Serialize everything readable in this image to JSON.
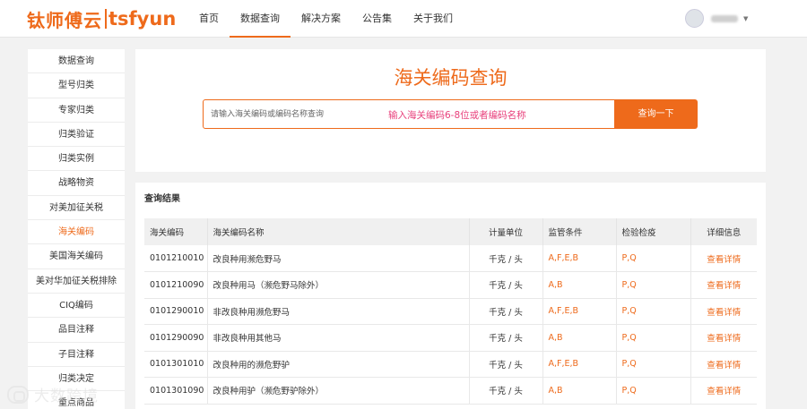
{
  "header": {
    "logo_cn": "钛师傅云",
    "logo_en": "tsfyun",
    "nav": [
      "首页",
      "数据查询",
      "解决方案",
      "公告集",
      "关于我们"
    ],
    "active_nav": "数据查询"
  },
  "sidebar": {
    "items": [
      "数据查询",
      "型号归类",
      "专家归类",
      "归类验证",
      "归类实例",
      "战略物资",
      "对美加征关税",
      "海关编码",
      "美国海关编码",
      "美对华加征关税排除",
      "CIQ编码",
      "品目注释",
      "子目注释",
      "归类决定",
      "重点商品"
    ],
    "active_item": "海关编码"
  },
  "search": {
    "title": "海关编码查询",
    "placeholder": "请输入海关编码或编码名称查询",
    "hint": "输入海关编码6-8位或者编码名称",
    "button": "查询一下"
  },
  "results": {
    "title": "查询结果",
    "columns": [
      "海关编码",
      "海关编码名称",
      "计量单位",
      "监管条件",
      "检验检疫",
      "详细信息"
    ],
    "rows": [
      [
        "0101210010",
        "改良种用濒危野马",
        "千克 / 头",
        "A,F,E,B",
        "P,Q",
        "查看详情"
      ],
      [
        "0101210090",
        "改良种用马（濒危野马除外）",
        "千克 / 头",
        "A,B",
        "P,Q",
        "查看详情"
      ],
      [
        "0101290010",
        "非改良种用濒危野马",
        "千克 / 头",
        "A,F,E,B",
        "P,Q",
        "查看详情"
      ],
      [
        "0101290090",
        "非改良种用其他马",
        "千克 / 头",
        "A,B",
        "P,Q",
        "查看详情"
      ],
      [
        "0101301010",
        "改良种用的濒危野驴",
        "千克 / 头",
        "A,F,E,B",
        "P,Q",
        "查看详情"
      ],
      [
        "0101301090",
        "改良种用驴（濒危野驴除外）",
        "千克 / 头",
        "A,B",
        "P,Q",
        "查看详情"
      ]
    ]
  },
  "watermark": {
    "text": "大数跨境",
    "icon": "watermark-logo-icon"
  },
  "colors": {
    "accent": "#ee6a1b",
    "hint": "#e8417c"
  }
}
